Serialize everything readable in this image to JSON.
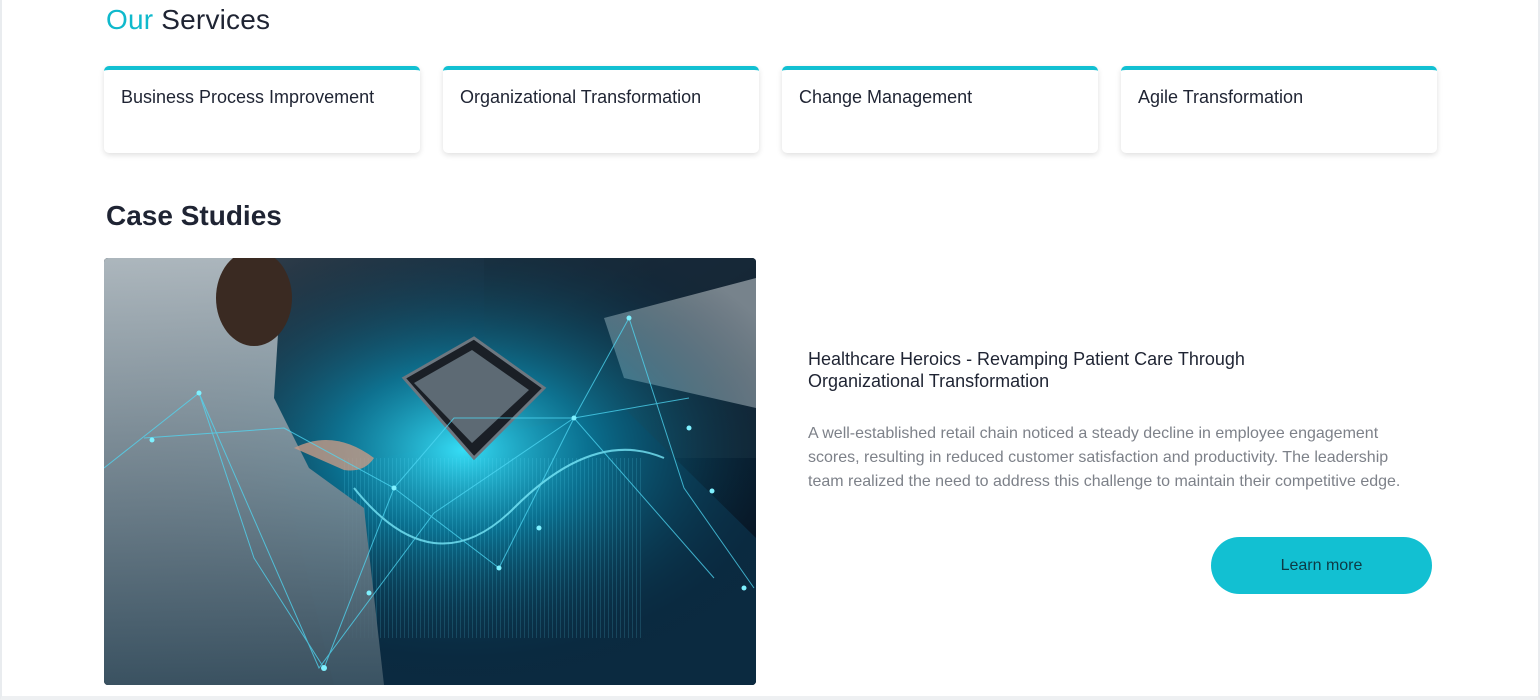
{
  "services": {
    "title_accent": "Our",
    "title_rest": "Services",
    "items": [
      {
        "label": "Business Process Improvement"
      },
      {
        "label": "Organizational Transformation"
      },
      {
        "label": "Change Management"
      },
      {
        "label": "Agile Transformation"
      }
    ]
  },
  "case_studies": {
    "title": "Case Studies",
    "image_icon": "person-using-tablet-with-digital-network-photo",
    "featured": {
      "heading": "Healthcare Heroics - Revamping Patient Care Through Organizational Transformation",
      "description": "A well-established retail chain noticed a steady decline in employee engagement scores, resulting in reduced customer satisfaction and productivity. The leadership team realized the need to address this challenge to maintain their competitive edge.",
      "button_label": "Learn more"
    }
  },
  "colors": {
    "accent": "#12c0d2",
    "heading": "#1f2433",
    "body_text": "#7d8189"
  }
}
